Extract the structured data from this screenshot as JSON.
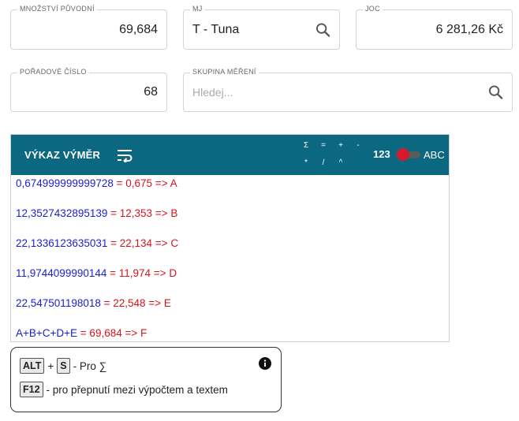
{
  "fields": {
    "mnozstvi": {
      "label": "MNOŽSTVÍ PŮVODNÍ",
      "value": "69,684"
    },
    "mj": {
      "label": "MJ",
      "value": "T - Tuna"
    },
    "joc": {
      "label": "JOC",
      "value": "6 281,26 Kč"
    },
    "poradove": {
      "label": "POŘADOVÉ ČÍSLO",
      "value": "68"
    },
    "skupina": {
      "label": "SKUPINA MĚŘENÍ",
      "placeholder": "Hledej..."
    }
  },
  "panel": {
    "title": "VÝKAZ VÝMĚR",
    "ops": [
      "Σ",
      "=",
      "+",
      "-",
      "*",
      "/",
      "^"
    ],
    "toggle_left": "123",
    "toggle_right": "ABC",
    "lines": [
      {
        "expr": "0,674999999999728",
        "result": " = 0,675 => A"
      },
      {
        "expr": "12,3527432895139",
        "result": " = 12,353 => B"
      },
      {
        "expr": "22,1336123635031",
        "result": " = 22,134 => C"
      },
      {
        "expr": "11,9744099990144",
        "result": " = 11,974 => D"
      },
      {
        "expr": "22,547501198018",
        "result": " = 22,548 => E"
      },
      {
        "expr": "A+B+C+D+E",
        "result": " = 69,684 => F"
      }
    ]
  },
  "hint": {
    "key_alt": "ALT",
    "plus": "+",
    "key_s": "S",
    "sum_text": "- Pro ∑",
    "key_f12": "F12",
    "f12_text": "- pro přepnutí mezi výpočtem a textem"
  },
  "colors": {
    "header_bg": "#0c6880",
    "expr": "#1b1fd0",
    "result": "#d8141e",
    "toggle_knob": "#d51a2b"
  }
}
